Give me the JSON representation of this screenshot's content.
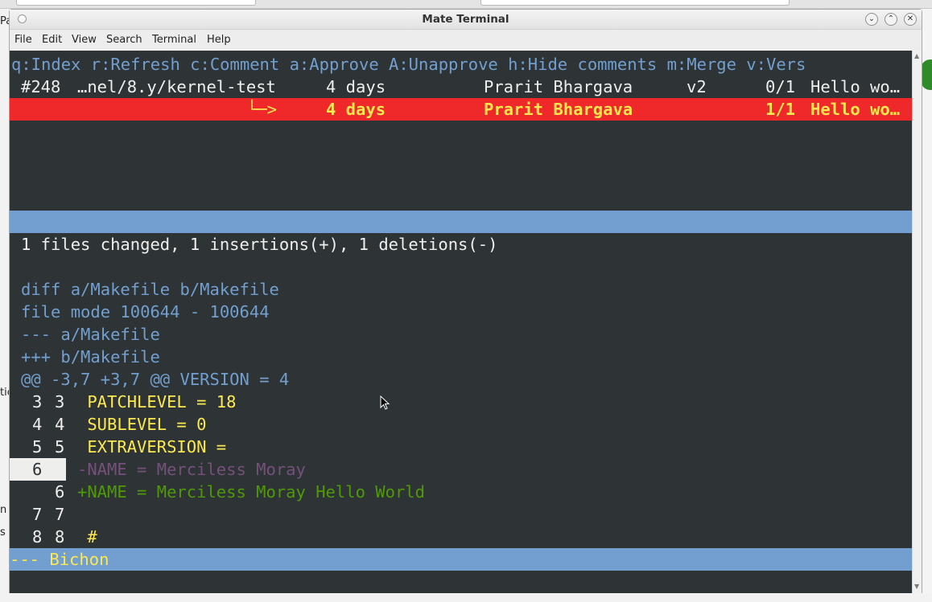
{
  "window": {
    "title": "Mate Terminal",
    "menu": [
      "File",
      "Edit",
      "View",
      "Search",
      "Terminal",
      "Help"
    ]
  },
  "background": {
    "left_fragments": [
      "Pa",
      "tic",
      "n",
      "s"
    ]
  },
  "terminal": {
    "help_bar": "q:Index r:Refresh c:Comment a:Approve A:Unapprove h:Hide comments m:Merge v:Vers",
    "mr_rows": [
      {
        "id": "#248",
        "branch": "…nel/8.y/kernel-test",
        "age": "4 days",
        "author": "Prarit Bhargava",
        "version": "v2",
        "count": "0/1",
        "title": "Hello wo…"
      },
      {
        "arrow": "└─>",
        "age": "4 days",
        "author": "Prarit Bhargava",
        "count": "1/1",
        "title": "Hello wo…"
      }
    ],
    "summary": "1 files changed, 1 insertions(+), 1 deletions(-)",
    "diff_header": [
      "diff a/Makefile b/Makefile",
      "file mode 100644 - 100644",
      "--- a/Makefile",
      "+++ b/Makefile"
    ],
    "hunk": "@@ -3,7 +3,7 @@ VERSION = 4",
    "lines": [
      {
        "old": "3",
        "new": "3",
        "text": " PATCHLEVEL = 18"
      },
      {
        "old": "4",
        "new": "4",
        "text": " SUBLEVEL = 0"
      },
      {
        "old": "5",
        "new": "5",
        "text": " EXTRAVERSION ="
      },
      {
        "old": "6",
        "new": "",
        "text": "-NAME = Merciless Moray"
      },
      {
        "old": "",
        "new": "6",
        "text": "+NAME = Merciless Moray Hello World"
      },
      {
        "old": "7",
        "new": "7",
        "text": ""
      },
      {
        "old": "8",
        "new": "8",
        "text": " #"
      }
    ],
    "status_bar": "--- Bichon"
  },
  "colors": {
    "term_bg": "#2e3436",
    "help_yellow": "#fce94f",
    "selected_red": "#ef2929",
    "bar_blue": "#729fcf",
    "diff_blue": "#729fcf",
    "removed_purple": "#75507b",
    "added_green": "#4e9a06",
    "text_white": "#eeeeec"
  }
}
